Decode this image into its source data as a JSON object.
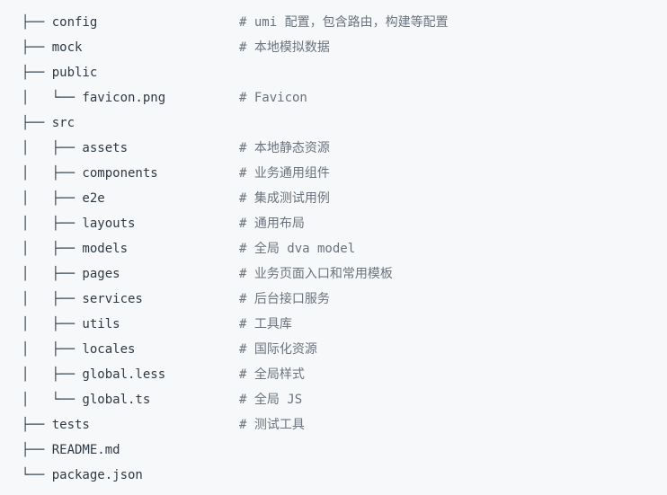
{
  "lines": [
    {
      "tree": "├── config",
      "comment": "# umi 配置，包含路由，构建等配置"
    },
    {
      "tree": "├── mock",
      "comment": "# 本地模拟数据"
    },
    {
      "tree": "├── public",
      "comment": ""
    },
    {
      "tree": "│   └── favicon.png",
      "comment": "# Favicon"
    },
    {
      "tree": "├── src",
      "comment": ""
    },
    {
      "tree": "│   ├── assets",
      "comment": "# 本地静态资源"
    },
    {
      "tree": "│   ├── components",
      "comment": "# 业务通用组件"
    },
    {
      "tree": "│   ├── e2e",
      "comment": "# 集成测试用例"
    },
    {
      "tree": "│   ├── layouts",
      "comment": "# 通用布局"
    },
    {
      "tree": "│   ├── models",
      "comment": "# 全局 dva model"
    },
    {
      "tree": "│   ├── pages",
      "comment": "# 业务页面入口和常用模板"
    },
    {
      "tree": "│   ├── services",
      "comment": "# 后台接口服务"
    },
    {
      "tree": "│   ├── utils",
      "comment": "# 工具库"
    },
    {
      "tree": "│   ├── locales",
      "comment": "# 国际化资源"
    },
    {
      "tree": "│   ├── global.less",
      "comment": "# 全局样式"
    },
    {
      "tree": "│   └── global.ts",
      "comment": "# 全局 JS"
    },
    {
      "tree": "├── tests",
      "comment": "# 测试工具"
    },
    {
      "tree": "├── README.md",
      "comment": ""
    },
    {
      "tree": "└── package.json",
      "comment": ""
    }
  ]
}
